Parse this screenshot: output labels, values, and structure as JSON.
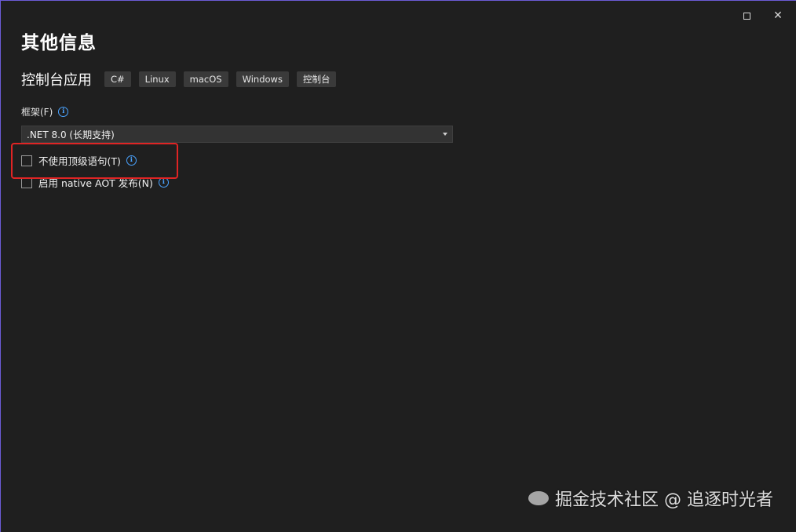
{
  "window": {
    "controls": {
      "maximize": "□",
      "close": "✕"
    }
  },
  "page": {
    "title": "其他信息"
  },
  "project": {
    "name": "控制台应用",
    "tags": [
      "C#",
      "Linux",
      "macOS",
      "Windows",
      "控制台"
    ]
  },
  "framework": {
    "label": "框架(F)",
    "selected": ".NET 8.0 (长期支持)"
  },
  "options": {
    "top_level": "不使用顶级语句(T)",
    "native_aot": "启用 native AOT 发布(N)"
  },
  "watermark": {
    "text": "掘金技术社区 @ 追逐时光者"
  },
  "colors": {
    "background": "#1f1f1f",
    "info_icon": "#4aa3ff",
    "highlight": "#e02424",
    "window_accent": "#6b5bd6"
  }
}
